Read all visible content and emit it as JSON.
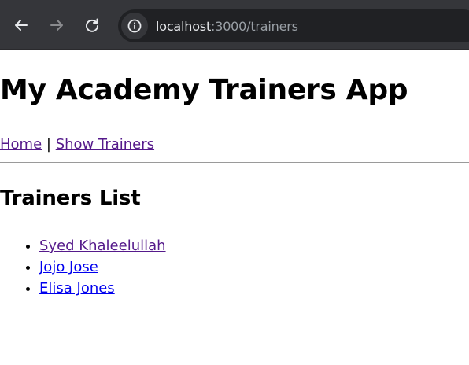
{
  "browser": {
    "url_host": "localhost",
    "url_path": ":3000/trainers",
    "icons": {
      "back": "arrow-left-icon",
      "forward": "arrow-right-icon",
      "reload": "reload-icon",
      "site_info": "info-circle-icon"
    }
  },
  "page": {
    "title": "My Academy Trainers App",
    "nav": {
      "home_label": "Home",
      "separator": "|",
      "show_trainers_label": "Show Trainers"
    },
    "section_heading": "Trainers List",
    "trainers": [
      {
        "name": "Syed Khaleelullah",
        "visited": true
      },
      {
        "name": "Jojo Jose",
        "visited": false
      },
      {
        "name": "Elisa Jones",
        "visited": false
      }
    ]
  },
  "colors": {
    "visited_link": "#551a8b",
    "unvisited_link": "#0000ee",
    "browser_toolbar": "#35363a",
    "omnibox": "#202124"
  }
}
